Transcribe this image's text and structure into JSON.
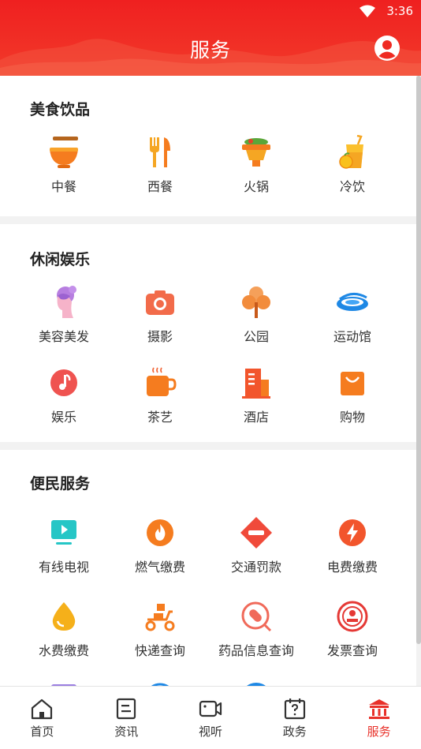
{
  "status_bar": {
    "time": "3:36"
  },
  "header": {
    "title": "服务"
  },
  "sections": [
    {
      "title": "美食饮品",
      "items": [
        {
          "label": "中餐",
          "icon": "chinese-food-icon"
        },
        {
          "label": "西餐",
          "icon": "fork-knife-icon"
        },
        {
          "label": "火锅",
          "icon": "hotpot-icon"
        },
        {
          "label": "冷饮",
          "icon": "cold-drink-icon"
        }
      ]
    },
    {
      "title": "休闲娱乐",
      "items": [
        {
          "label": "美容美发",
          "icon": "beauty-icon"
        },
        {
          "label": "摄影",
          "icon": "camera-icon"
        },
        {
          "label": "公园",
          "icon": "tree-icon"
        },
        {
          "label": "运动馆",
          "icon": "stadium-icon"
        },
        {
          "label": "娱乐",
          "icon": "music-icon"
        },
        {
          "label": "茶艺",
          "icon": "tea-cup-icon"
        },
        {
          "label": "酒店",
          "icon": "hotel-icon"
        },
        {
          "label": "购物",
          "icon": "shopping-bag-icon"
        }
      ]
    },
    {
      "title": "便民服务",
      "items": [
        {
          "label": "有线电视",
          "icon": "tv-icon"
        },
        {
          "label": "燃气缴费",
          "icon": "flame-icon"
        },
        {
          "label": "交通罚款",
          "icon": "no-entry-icon"
        },
        {
          "label": "电费缴费",
          "icon": "lightning-icon"
        },
        {
          "label": "水费缴费",
          "icon": "water-drop-icon"
        },
        {
          "label": "快递查询",
          "icon": "delivery-scooter-icon"
        },
        {
          "label": "药品信息查询",
          "icon": "pill-search-icon"
        },
        {
          "label": "发票查询",
          "icon": "invoice-seal-icon"
        }
      ]
    }
  ],
  "tabbar": {
    "tabs": [
      {
        "label": "首页",
        "icon": "home-icon",
        "active": false
      },
      {
        "label": "资讯",
        "icon": "news-icon",
        "active": false
      },
      {
        "label": "视听",
        "icon": "video-icon",
        "active": false
      },
      {
        "label": "政务",
        "icon": "calendar-question-icon",
        "active": false
      },
      {
        "label": "服务",
        "icon": "government-building-icon",
        "active": true
      }
    ]
  },
  "colors": {
    "brand": "#ef2020",
    "accent": "#e8312a"
  }
}
